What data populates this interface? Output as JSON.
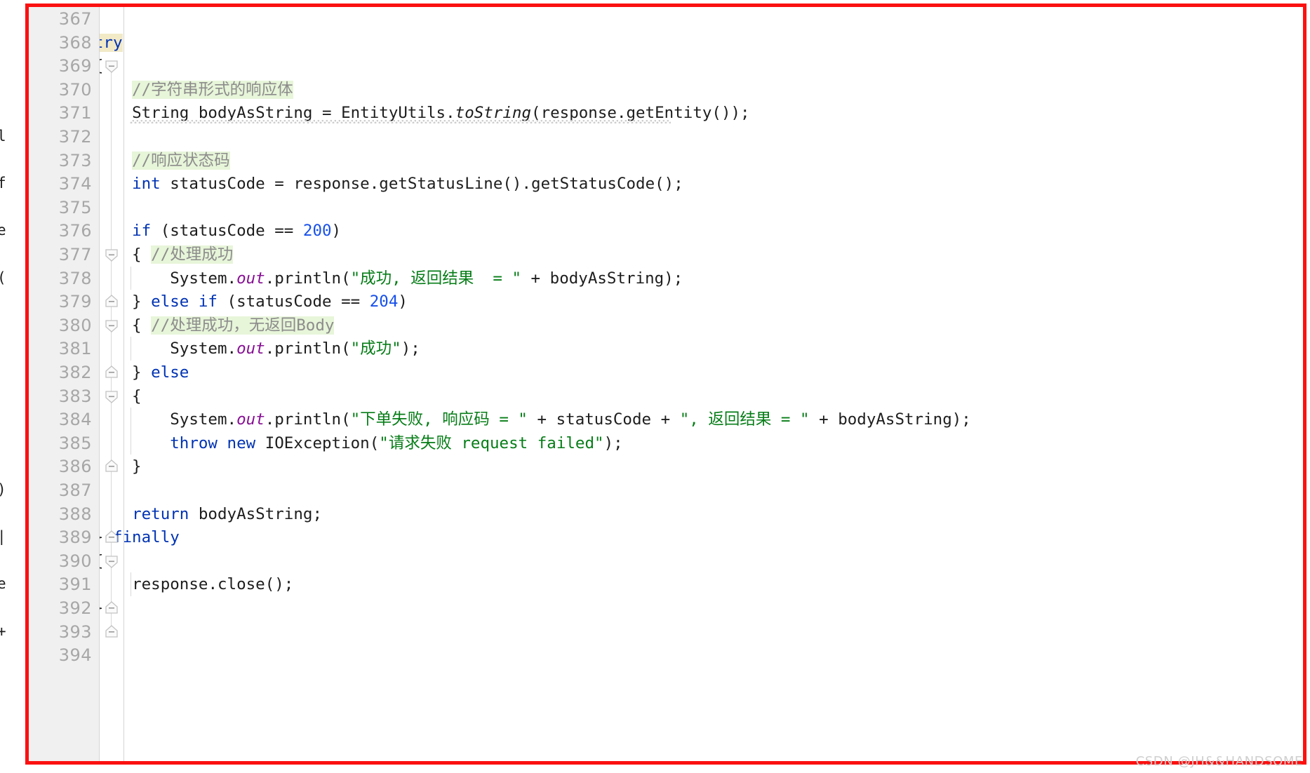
{
  "editor": {
    "language": "Java",
    "first_visible_line": 367,
    "last_visible_line": 394,
    "theme": "IntelliJ Light",
    "colors": {
      "keyword": "#0033b3",
      "number": "#1750eb",
      "string": "#067d17",
      "comment_text": "#8c8c8c",
      "comment_highlight_bg": "#e7f5d9",
      "static_field": "#871094",
      "plain_text": "#1d1d1d",
      "gutter_bg": "#f0f0f0",
      "line_number": "#a7a7a7",
      "annotation_border": "#fb1010",
      "search_highlight_bg": "#f2e9c7"
    }
  },
  "gutter": {
    "line_numbers": [
      "367",
      "368",
      "369",
      "370",
      "371",
      "372",
      "373",
      "374",
      "375",
      "376",
      "377",
      "378",
      "379",
      "380",
      "381",
      "382",
      "383",
      "384",
      "385",
      "386",
      "387",
      "388",
      "389",
      "390",
      "391",
      "392",
      "393",
      "394"
    ],
    "fold_markers": [
      {
        "line": "369",
        "type": "fold-start"
      },
      {
        "line": "377",
        "type": "fold-start"
      },
      {
        "line": "379",
        "type": "fold-end"
      },
      {
        "line": "380",
        "type": "fold-start"
      },
      {
        "line": "382",
        "type": "fold-end"
      },
      {
        "line": "383",
        "type": "fold-start"
      },
      {
        "line": "386",
        "type": "fold-end"
      },
      {
        "line": "389",
        "type": "fold-end"
      },
      {
        "line": "390",
        "type": "fold-start"
      },
      {
        "line": "392",
        "type": "fold-end"
      },
      {
        "line": "393",
        "type": "fold-end"
      }
    ]
  },
  "code_lines": [
    {
      "n": "367",
      "text": ""
    },
    {
      "n": "368",
      "text": "        try"
    },
    {
      "n": "369",
      "text": "        {"
    },
    {
      "n": "370",
      "text": "            //字符串形式的响应体"
    },
    {
      "n": "371",
      "text": "            String bodyAsString = EntityUtils.toString(response.getEntity());"
    },
    {
      "n": "372",
      "text": ""
    },
    {
      "n": "373",
      "text": "            //响应状态码"
    },
    {
      "n": "374",
      "text": "            int statusCode = response.getStatusLine().getStatusCode();"
    },
    {
      "n": "375",
      "text": ""
    },
    {
      "n": "376",
      "text": "            if (statusCode == 200)"
    },
    {
      "n": "377",
      "text": "            { //处理成功"
    },
    {
      "n": "378",
      "text": "                System.out.println(\"成功, 返回结果  = \" + bodyAsString);"
    },
    {
      "n": "379",
      "text": "            } else if (statusCode == 204)"
    },
    {
      "n": "380",
      "text": "            { //处理成功，无返回Body"
    },
    {
      "n": "381",
      "text": "                System.out.println(\"成功\");"
    },
    {
      "n": "382",
      "text": "            } else"
    },
    {
      "n": "383",
      "text": "            {"
    },
    {
      "n": "384",
      "text": "                System.out.println(\"下单失败, 响应码 = \" + statusCode + \", 返回结果 = \" + bodyAsString);"
    },
    {
      "n": "385",
      "text": "                throw new IOException(\"请求失败 request failed\");"
    },
    {
      "n": "386",
      "text": "            }"
    },
    {
      "n": "387",
      "text": ""
    },
    {
      "n": "388",
      "text": "            return bodyAsString;"
    },
    {
      "n": "389",
      "text": "        } finally"
    },
    {
      "n": "390",
      "text": "        {"
    },
    {
      "n": "391",
      "text": "            response.close();"
    },
    {
      "n": "392",
      "text": "        }"
    },
    {
      "n": "393",
      "text": "    }"
    },
    {
      "n": "394",
      "text": ""
    }
  ],
  "tokens": {
    "keywords": [
      "try",
      "int",
      "if",
      "else",
      "throw",
      "new",
      "return",
      "finally"
    ],
    "numbers": [
      "200",
      "204"
    ],
    "strings": [
      "\"成功, 返回结果  = \"",
      "\"成功\"",
      "\"下单失败, 响应码 = \"",
      "\", 返回结果 = \"",
      "\"请求失败 request failed\""
    ],
    "comments": [
      "//字符串形式的响应体",
      "//响应状态码",
      "//处理成功",
      "//处理成功，无返回Body"
    ],
    "static_fields": [
      "out"
    ],
    "italic_methods": [
      "toString"
    ],
    "highlighted_word": "try"
  },
  "watermark": {
    "text": "CSDN @JH&&HANDSOME"
  },
  "left_fragments": [
    "",
    "",
    "",
    "",
    "",
    "l",
    "",
    "f",
    "",
    "e",
    "",
    "(",
    "",
    "",
    "",
    "",
    "",
    "",
    "",
    "",
    ")",
    "",
    "|",
    "",
    "e",
    "",
    "+",
    "",
    "",
    "",
    "",
    "",
    "",
    "",
    "",
    "",
    "",
    "",
    "",
    "",
    ""
  ]
}
